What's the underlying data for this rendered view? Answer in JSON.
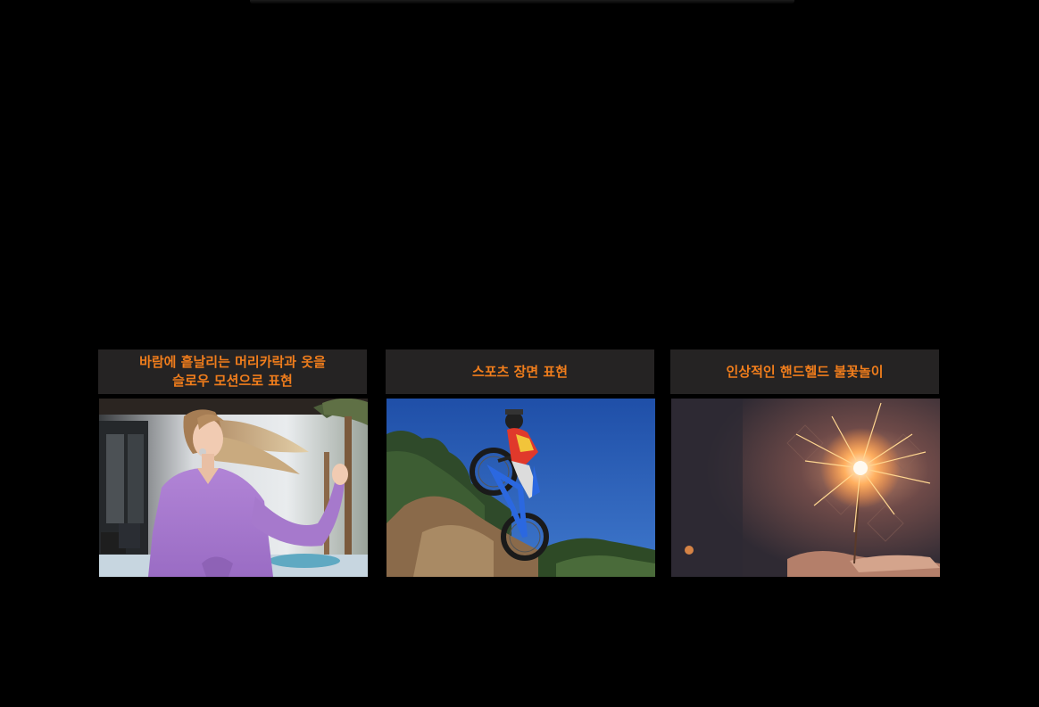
{
  "cards": [
    {
      "caption": "바람에 흩날리는 머리카락과 옷을\n슬로우 모션으로 표현",
      "image": "woman-hair-blowing-photo"
    },
    {
      "caption": "스포츠 장면 표현",
      "image": "bmx-rider-jump-photo"
    },
    {
      "caption": "인상적인 핸드헬드 불꽃놀이",
      "image": "sparkler-in-hands-photo"
    }
  ],
  "colors": {
    "background": "#000000",
    "caption_bg": "#252323",
    "caption_text": "#f07d1c"
  }
}
